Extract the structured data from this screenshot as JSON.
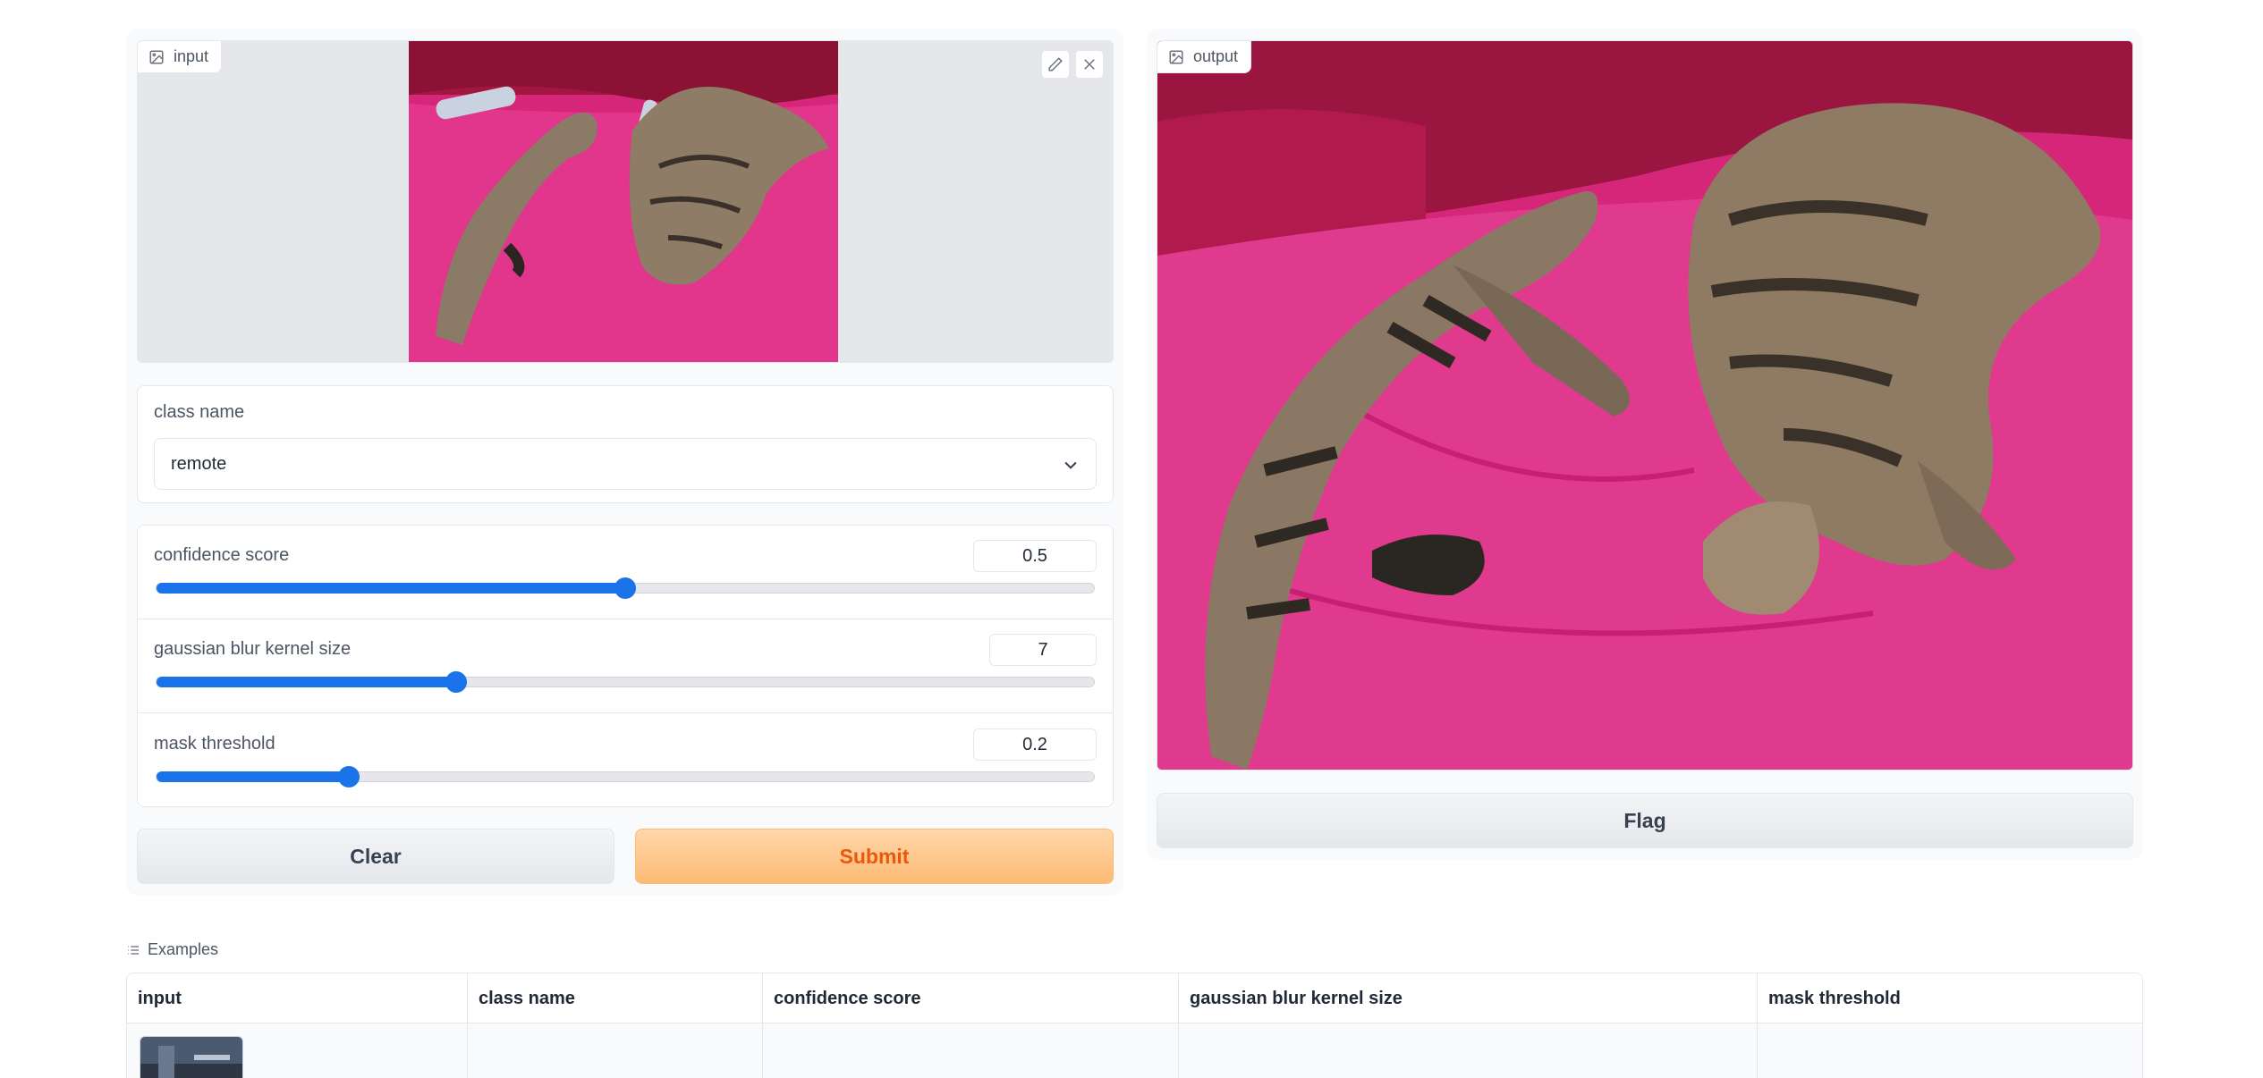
{
  "input_image": {
    "label": "input",
    "tools": [
      "edit-icon",
      "close-icon"
    ]
  },
  "class_name": {
    "label": "class name",
    "selected": "remote"
  },
  "sliders": [
    {
      "label": "confidence score",
      "value": "0.5",
      "fraction": 0.5
    },
    {
      "label": "gaussian blur kernel size",
      "value": "7",
      "fraction": 0.32
    },
    {
      "label": "mask threshold",
      "value": "0.2",
      "fraction": 0.205
    }
  ],
  "buttons": {
    "clear": "Clear",
    "submit": "Submit",
    "flag": "Flag"
  },
  "output_image": {
    "label": "output"
  },
  "examples": {
    "label": "Examples",
    "columns": [
      "input",
      "class name",
      "confidence score",
      "gaussian blur kernel size",
      "mask threshold"
    ]
  },
  "colors": {
    "slider_accent": "#1a73e8",
    "submit_bg": "#fdba74",
    "submit_text": "#ea580c",
    "couch_pink": "#d6267a"
  }
}
